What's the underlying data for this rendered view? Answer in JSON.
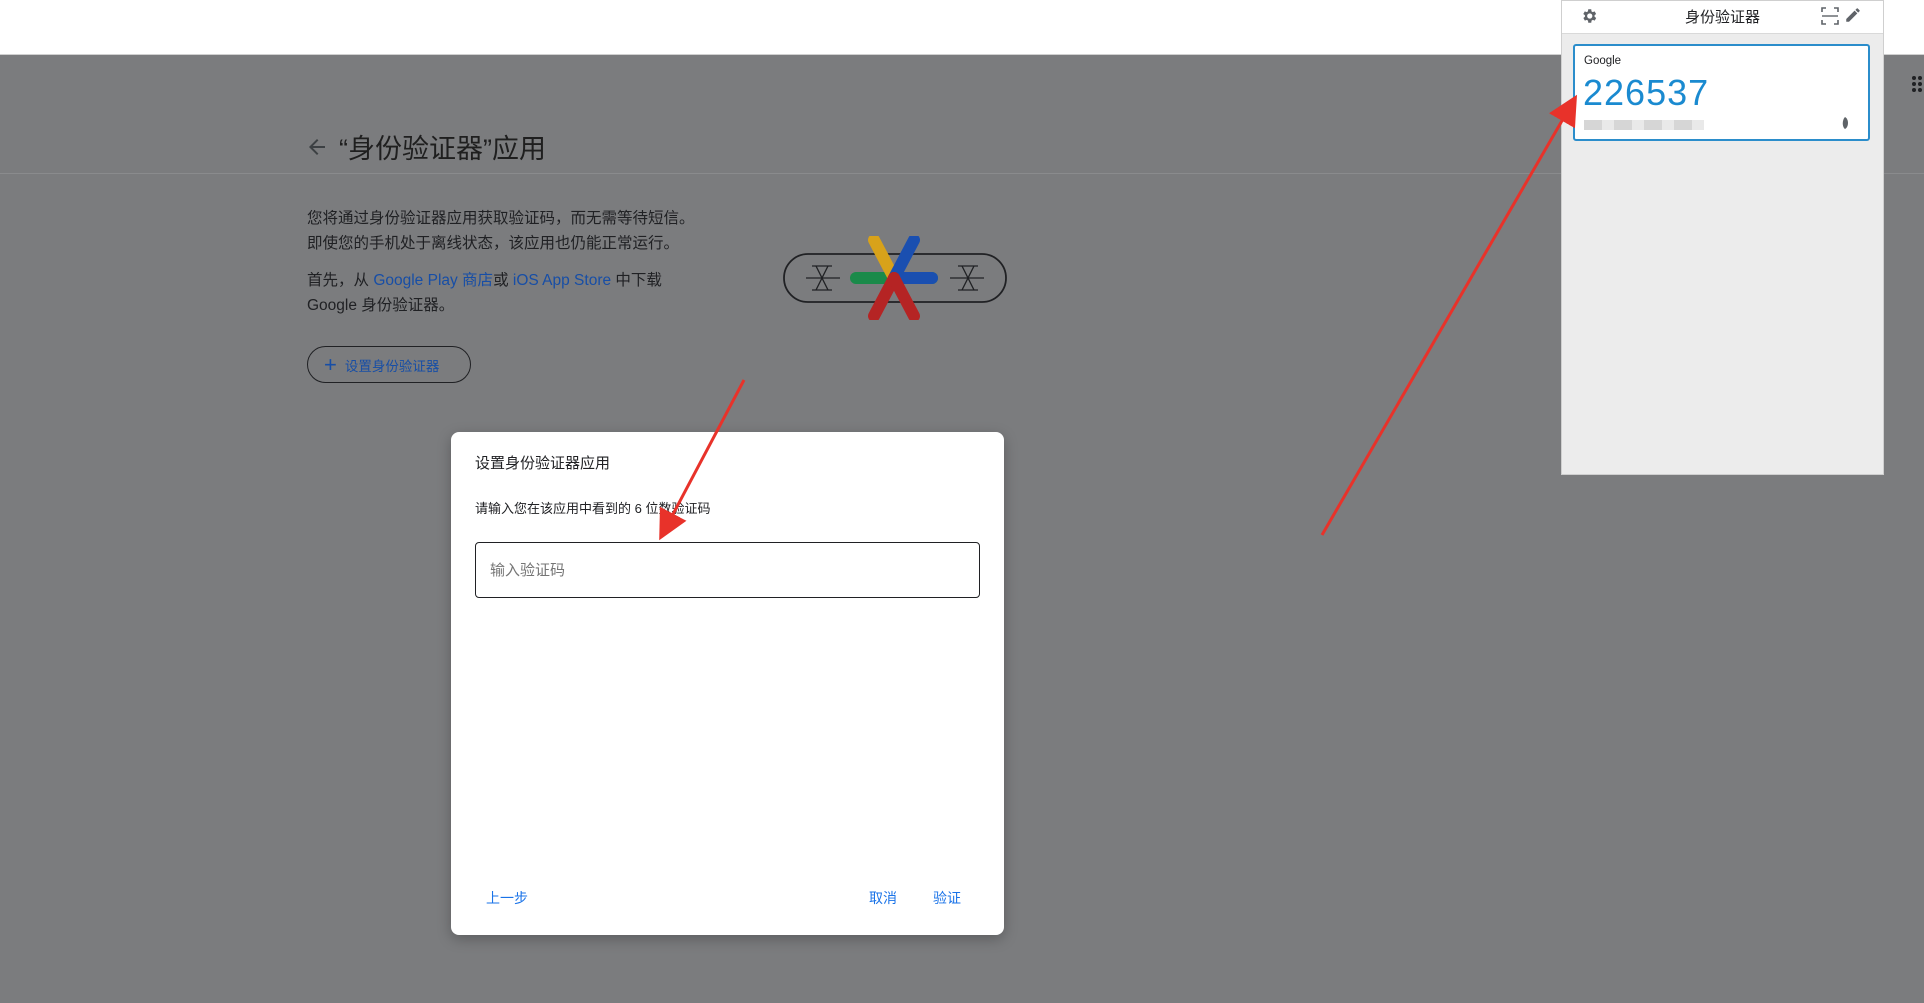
{
  "page": {
    "title": "“身份验证器”应用",
    "desc_line1": "您将通过身份验证器应用获取验证码，而无需等待短信。",
    "desc_line2": "即使您的手机处于离线状态，该应用也仍能正常运行。",
    "desc2_prefix": "首先，从 ",
    "google_play_link": "Google Play 商店",
    "desc2_or": "或 ",
    "ios_link": "iOS App Store",
    "desc2_suffix": " 中下载",
    "desc2_line2": "Google 身份验证器。",
    "setup_button": "设置身份验证器"
  },
  "dialog": {
    "title": "设置身份验证器应用",
    "subtitle": "请输入您在该应用中看到的 6 位数验证码",
    "input_placeholder": "输入验证码",
    "back_button": "上一步",
    "cancel_button": "取消",
    "verify_button": "验证"
  },
  "extension": {
    "title": "身份验证器",
    "issuer": "Google",
    "code": "226537"
  },
  "colors": {
    "accent": "#1a73e8",
    "link": "#174ea6",
    "code": "#1a8ad0",
    "arrow": "#e8322a"
  }
}
